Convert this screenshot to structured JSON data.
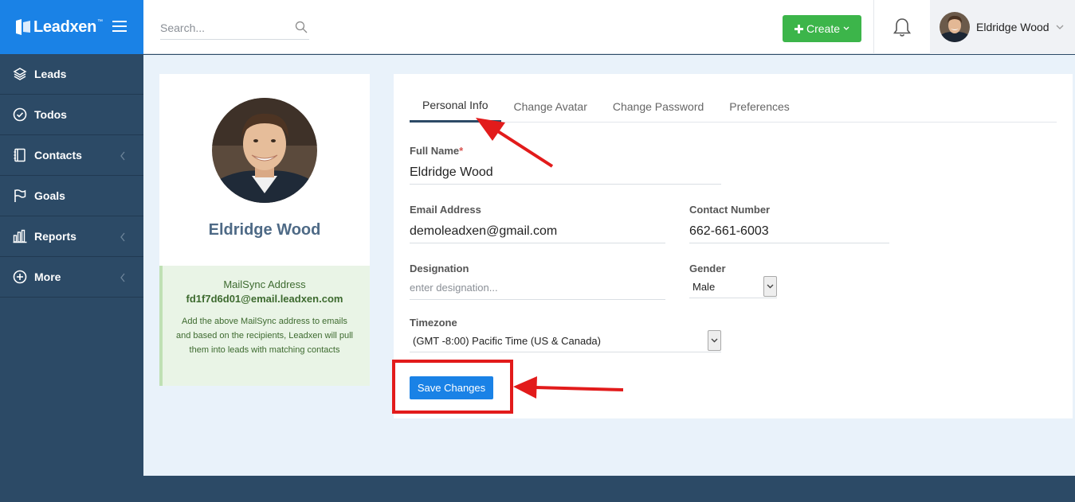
{
  "brand": {
    "name": "Leadxen",
    "tm": "™"
  },
  "search": {
    "placeholder": "Search..."
  },
  "header": {
    "create_label": "Create"
  },
  "user": {
    "name": "Eldridge Wood"
  },
  "sidebar": {
    "items": [
      {
        "label": "Leads",
        "icon": "layers-icon",
        "has_submenu": false
      },
      {
        "label": "Todos",
        "icon": "check-circle-icon",
        "has_submenu": false
      },
      {
        "label": "Contacts",
        "icon": "address-book-icon",
        "has_submenu": true
      },
      {
        "label": "Goals",
        "icon": "flag-icon",
        "has_submenu": false
      },
      {
        "label": "Reports",
        "icon": "bar-chart-icon",
        "has_submenu": true
      },
      {
        "label": "More",
        "icon": "plus-circle-icon",
        "has_submenu": true
      }
    ]
  },
  "profile": {
    "name": "Eldridge Wood",
    "mailsync_title": "MailSync Address",
    "mailsync_address": "fd1f7d6d01@email.leadxen.com",
    "mailsync_desc": "Add the above MailSync address to emails and based on the recipients, Leadxen will pull them into leads with matching contacts"
  },
  "tabs": [
    {
      "label": "Personal Info",
      "active": true
    },
    {
      "label": "Change Avatar",
      "active": false
    },
    {
      "label": "Change Password",
      "active": false
    },
    {
      "label": "Preferences",
      "active": false
    }
  ],
  "form": {
    "full_name_label": "Full Name",
    "required_mark": "*",
    "full_name_value": "Eldridge Wood",
    "email_label": "Email Address",
    "email_value": "demoleadxen@gmail.com",
    "contact_label": "Contact Number",
    "contact_value": "662-661-6003",
    "designation_label": "Designation",
    "designation_placeholder": "enter designation...",
    "gender_label": "Gender",
    "gender_value": "Male",
    "timezone_label": "Timezone",
    "timezone_value": "(GMT -8:00) Pacific Time (US & Canada)",
    "save_label": "Save Changes"
  },
  "colors": {
    "brand_blue": "#1a82e6",
    "sidebar": "#2c4a66",
    "create_green": "#3cb54a",
    "annotation_red": "#e21b1b"
  }
}
